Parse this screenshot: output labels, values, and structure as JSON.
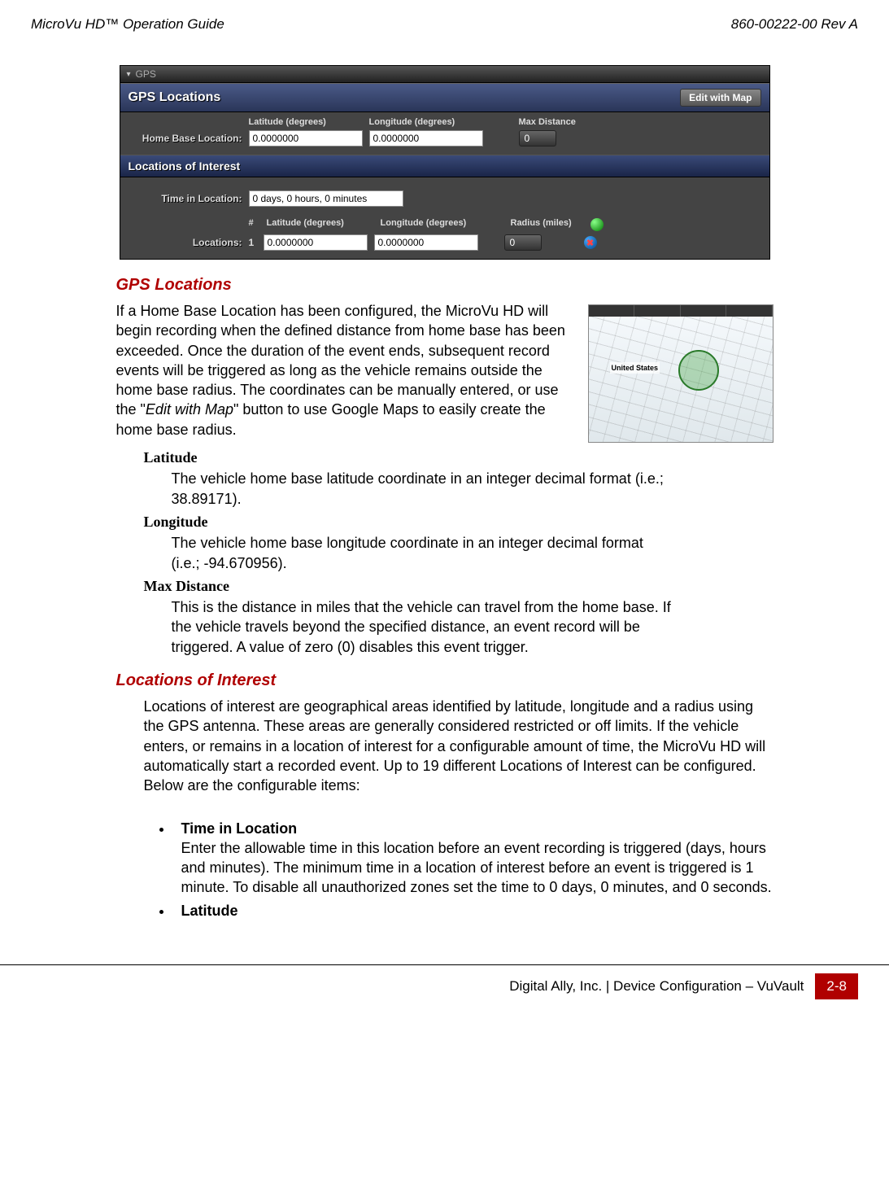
{
  "header": {
    "left": "MicroVu HD™ Operation Guide",
    "right": "860-00222-00 Rev A"
  },
  "screenshot": {
    "topbar": "GPS",
    "section_title": "GPS Locations",
    "edit_btn": "Edit with Map",
    "col_lat": "Latitude (degrees)",
    "col_lon": "Longitude (degrees)",
    "col_maxdist": "Max Distance",
    "home_label": "Home Base Location:",
    "home_lat": "0.0000000",
    "home_lon": "0.0000000",
    "home_max": "0",
    "loi_title": "Locations of Interest",
    "time_label": "Time in Location:",
    "time_value": "0 days, 0 hours, 0 minutes",
    "col_num": "#",
    "col_radius": "Radius (miles)",
    "loc_label": "Locations:",
    "row_num": "1",
    "row_lat": "0.0000000",
    "row_lon": "0.0000000",
    "row_radius": "0"
  },
  "doc": {
    "h1": "GPS Locations",
    "p1a": "If a Home Base Location has been configured, the MicroVu HD will begin recording when the defined distance from home base has been exceeded. Once the duration of the event ends, subsequent record events will be triggered as long as the vehicle remains outside the home base radius. The coordinates can be manually entered, or use the \"",
    "p1b": "Edit with Map",
    "p1c": "\" button to use Google Maps to easily create the home base radius.",
    "map_label": "United States",
    "lat_t": "Latitude",
    "lat_d": "The vehicle home base latitude coordinate in an integer decimal format (i.e.; 38.89171).",
    "lon_t": "Longitude",
    "lon_d": "The vehicle home base longitude coordinate in an integer decimal format (i.e.; -94.670956).",
    "max_t": "Max Distance",
    "max_d": "This is the distance in miles that the vehicle can travel from the home base. If the vehicle travels beyond the specified distance, an event record will be triggered. A value of zero (0) disables this event trigger.",
    "h2": "Locations of Interest",
    "p2": "Locations of interest are geographical areas identified by latitude, longitude and a radius using the GPS antenna. These areas are generally considered restricted or off limits. If the vehicle enters, or remains in a location of interest for a configurable amount of time, the MicroVu HD will automatically start a recorded event. Up to 19 different Locations of Interest can be configured. Below are the configurable items:",
    "b1_t": "Time in Location",
    "b1_d": "Enter the allowable time in this location before an event recording is triggered (days, hours and minutes). The minimum time in a location of interest before an event is triggered is 1 minute. To disable all unauthorized zones set the time to 0 days, 0 minutes, and 0 seconds.",
    "b2_t": "Latitude"
  },
  "footer": {
    "text": "Digital Ally, Inc. | Device Configuration – VuVault",
    "page": "2-8"
  }
}
